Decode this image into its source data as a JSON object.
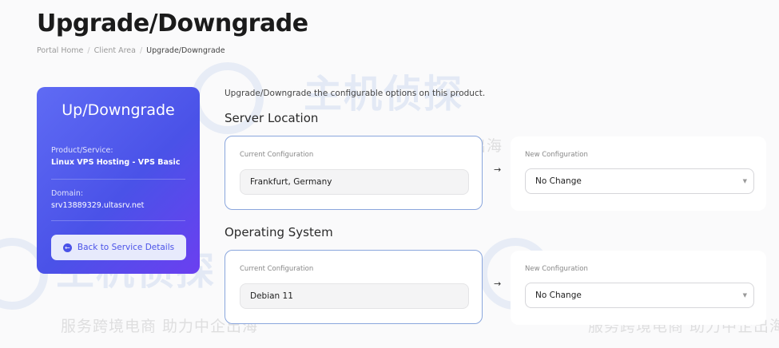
{
  "page": {
    "title": "Upgrade/Downgrade",
    "breadcrumb": [
      "Portal Home",
      "Client Area",
      "Upgrade/Downgrade"
    ]
  },
  "watermark": {
    "brand": "主机侦探",
    "slogan": "服务跨境电商 助力中企出海"
  },
  "sidebar": {
    "title": "Up/Downgrade",
    "product_label": "Product/Service:",
    "product_value": "Linux VPS Hosting - VPS Basic",
    "domain_label": "Domain:",
    "domain_value": "srv13889329.ultasrv.net",
    "back_button": "Back to Service Details"
  },
  "main": {
    "intro": "Upgrade/Downgrade the configurable options on this product.",
    "options": [
      {
        "title": "Server Location",
        "current_label": "Current Configuration",
        "current_value": "Frankfurt, Germany",
        "arrow": "→",
        "new_label": "New Configuration",
        "new_value": "No Change"
      },
      {
        "title": "Operating System",
        "current_label": "Current Configuration",
        "current_value": "Debian 11",
        "arrow": "→",
        "new_label": "New Configuration",
        "new_value": "No Change"
      }
    ]
  },
  "colors": {
    "accent": "#4a52e8",
    "border_active": "#8aa6dd"
  }
}
